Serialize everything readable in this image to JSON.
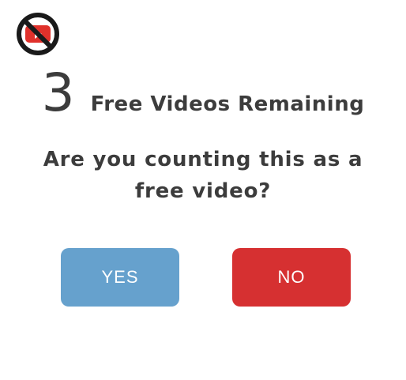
{
  "logo": {
    "icon": "no-youtube-icon",
    "colors": {
      "ring": "#1a1a1a",
      "play": "#e0312b",
      "glyph": "#ffffff"
    }
  },
  "counter": {
    "number": "3",
    "label": "Free Videos Remaining"
  },
  "prompt": {
    "question": "Are you counting this as a free video?"
  },
  "buttons": {
    "yes": {
      "label": "YES",
      "color": "#66a1cd"
    },
    "no": {
      "label": "NO",
      "color": "#d63031"
    }
  }
}
